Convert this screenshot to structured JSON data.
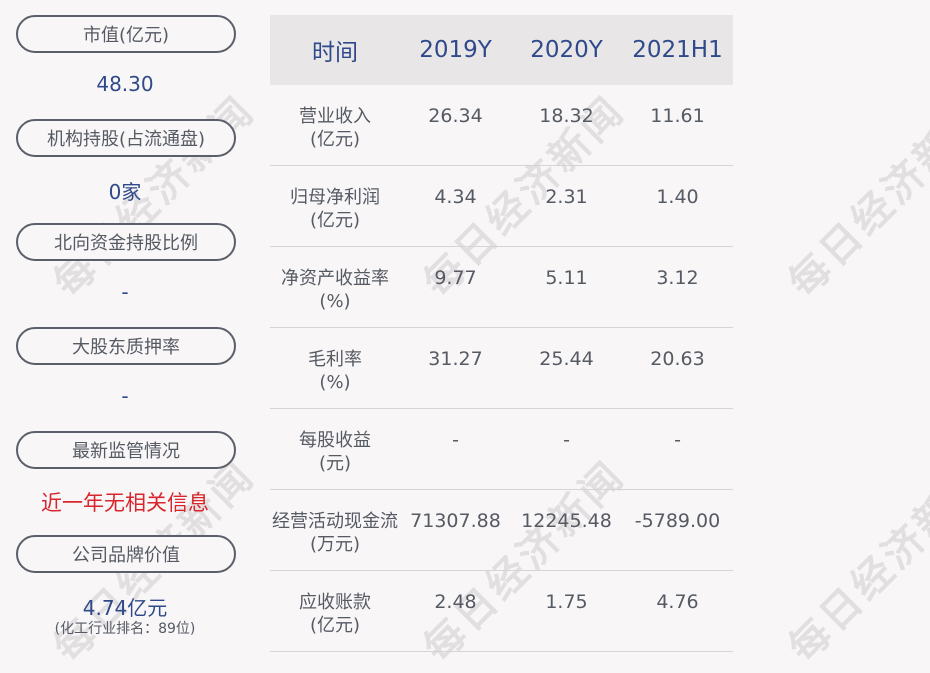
{
  "left_panel": {
    "market_cap": {
      "label": "市值(亿元)",
      "value": "48.30"
    },
    "institution_holding": {
      "label": "机构持股(占流通盘)",
      "value": "0家"
    },
    "northbound_holding": {
      "label": "北向资金持股比例",
      "value": "-"
    },
    "major_shareholder_pledge": {
      "label": "大股东质押率",
      "value": "-"
    },
    "regulatory_status": {
      "label": "最新监管情况",
      "value": "近一年无相关信息"
    },
    "brand_value": {
      "label": "公司品牌价值",
      "value": "4.74亿元",
      "note": "(化工行业排名：89位)"
    }
  },
  "table": {
    "header": [
      "时间",
      "2019Y",
      "2020Y",
      "2021H1"
    ],
    "rows": [
      {
        "label1": "营业收入",
        "label2": "(亿元)",
        "values": [
          "26.34",
          "18.32",
          "11.61"
        ]
      },
      {
        "label1": "归母净利润",
        "label2": "(亿元)",
        "values": [
          "4.34",
          "2.31",
          "1.40"
        ]
      },
      {
        "label1": "净资产收益率",
        "label2": "(%)",
        "values": [
          "9.77",
          "5.11",
          "3.12"
        ]
      },
      {
        "label1": "毛利率",
        "label2": "(%)",
        "values": [
          "31.27",
          "25.44",
          "20.63"
        ]
      },
      {
        "label1": "每股收益",
        "label2": "(元)",
        "values": [
          "-",
          "-",
          "-"
        ]
      },
      {
        "label1": "经营活动现金流",
        "label2": "(万元)",
        "values": [
          "71307.88",
          "12245.48",
          "-5789.00"
        ]
      },
      {
        "label1": "应收账款",
        "label2": "(亿元)",
        "values": [
          "2.48",
          "1.75",
          "4.76"
        ]
      }
    ]
  },
  "watermark_text": "每日经济新闻"
}
